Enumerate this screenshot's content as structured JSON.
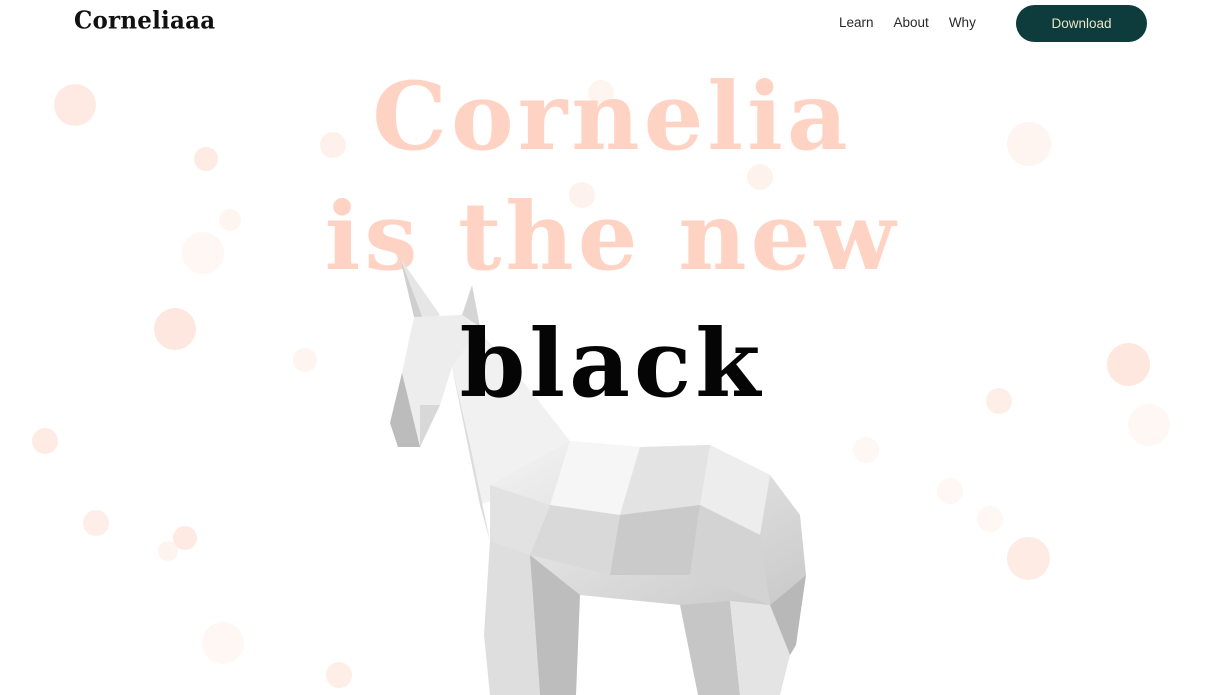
{
  "header": {
    "logo": "Corneliaaa",
    "nav": [
      {
        "label": "Learn"
      },
      {
        "label": "About"
      },
      {
        "label": "Why"
      }
    ],
    "download_label": "Download"
  },
  "hero": {
    "line1": "Cornelia",
    "line2": "is the new",
    "line3": "black",
    "illustration": "unicorn-icon"
  },
  "colors": {
    "accent_dark": "#0e3b3b",
    "button_text": "#e8e5c9",
    "headline_peach": "#ffd3c4",
    "bubble": "#fde3d8"
  }
}
